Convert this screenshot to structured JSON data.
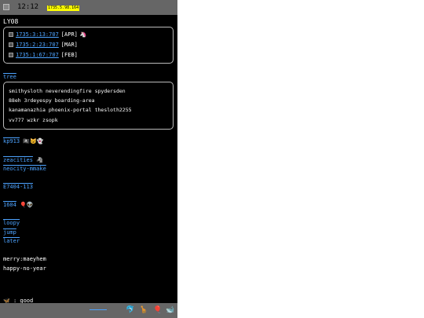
{
  "status": {
    "time": "12:12",
    "date_badge": "1735.5.98.164"
  },
  "log": {
    "title": "LY08",
    "entries": [
      {
        "date": "1735:3:13:707",
        "tag": "[APR]",
        "emoji": "🦄"
      },
      {
        "date": "1735:2:23:707",
        "tag": "[MAR]",
        "emoji": ""
      },
      {
        "date": "1735:1:67:707",
        "tag": "[FEB]",
        "emoji": ""
      }
    ]
  },
  "tree": {
    "label": "tree",
    "lines": [
      "smithysloth neverendingfire spydersden",
      "88eh 3rdeyespy boarding-area",
      "kanamanazhia phoenix-portal thesloth2255",
      "vv777 wzkr zsopk"
    ]
  },
  "links": {
    "kp913": "kp913",
    "kp913_emoji": "🏴‍☠️😺👻",
    "zeacities": "zeacities",
    "zeacities_emoji": "🦓",
    "neocity": "neocity-mmake",
    "e7404": "E7404-113",
    "i604": "1604",
    "i604_emoji": "🎈👽",
    "loopy": "loopy",
    "jump": "jump",
    "later": "later"
  },
  "notes": {
    "line1": "merry:maeyhem",
    "line2": "happy-no-year",
    "bottom": ": good",
    "bottom_emoji": "🦋"
  },
  "bottombar": {
    "icons": [
      "🐬",
      "🦒",
      "🎈",
      "🐋"
    ]
  }
}
